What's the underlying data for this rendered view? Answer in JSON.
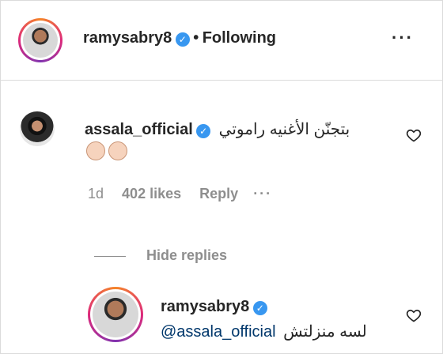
{
  "post_header": {
    "username": "ramysabry8",
    "separator": "•",
    "follow_status": "Following",
    "more_icon": "more-horizontal-icon"
  },
  "comment": {
    "username": "assala_official",
    "text": "بتجنّن الأغنيه راموتي",
    "emojis": [
      "clapping-hands",
      "clapping-hands"
    ],
    "time": "1d",
    "likes": "402 likes",
    "reply_label": "Reply",
    "more_icon": "more-horizontal-icon"
  },
  "replies_toggle": {
    "label": "Hide replies"
  },
  "reply": {
    "username": "ramysabry8",
    "text": "لسه منزلتش",
    "mention": "@assala_official"
  },
  "colors": {
    "verified": "#3897f0",
    "muted": "#8e8e8e",
    "text": "#262626",
    "mention": "#00376b"
  }
}
